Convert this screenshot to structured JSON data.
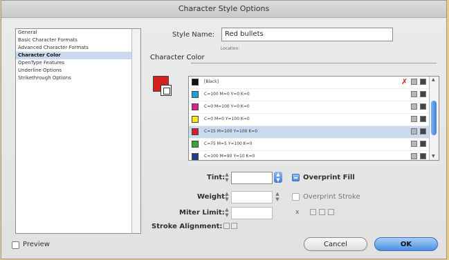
{
  "window": {
    "title": "Character Style Options"
  },
  "sidebar": {
    "items": [
      {
        "label": "General"
      },
      {
        "label": "Basic Character Formats"
      },
      {
        "label": "Advanced Character Formats"
      },
      {
        "label": "Character Color"
      },
      {
        "label": "OpenType Features"
      },
      {
        "label": "Underline Options"
      },
      {
        "label": "Strikethrough Options"
      }
    ]
  },
  "style_name": {
    "label": "Style Name:",
    "value": "Red bullets"
  },
  "location_label": "Location:",
  "section": {
    "title": "Character Color"
  },
  "swatches": [
    {
      "name": "[Black]",
      "color": "#111111"
    },
    {
      "name": "C=100 M=0 Y=0 K=0",
      "color": "#1aa0e0"
    },
    {
      "name": "C=0 M=100 Y=0 K=0",
      "color": "#e0208a"
    },
    {
      "name": "C=0 M=0 Y=100 K=0",
      "color": "#f4e61a"
    },
    {
      "name": "C=15 M=100 Y=100 K=0",
      "color": "#d32027"
    },
    {
      "name": "C=75 M=5 Y=100 K=0",
      "color": "#3aa635"
    },
    {
      "name": "C=100 M=90 Y=10 K=0",
      "color": "#233b8f"
    }
  ],
  "fields": {
    "tint_label": "Tint:",
    "weight_label": "Weight:",
    "miter_label": "Miter Limit:",
    "miter_unit": "x",
    "stroke_alignment_label": "Stroke Alignment:",
    "overprint_fill": "Overprint Fill",
    "overprint_stroke": "Overprint Stroke"
  },
  "footer": {
    "preview": "Preview",
    "cancel": "Cancel",
    "ok": "OK"
  }
}
